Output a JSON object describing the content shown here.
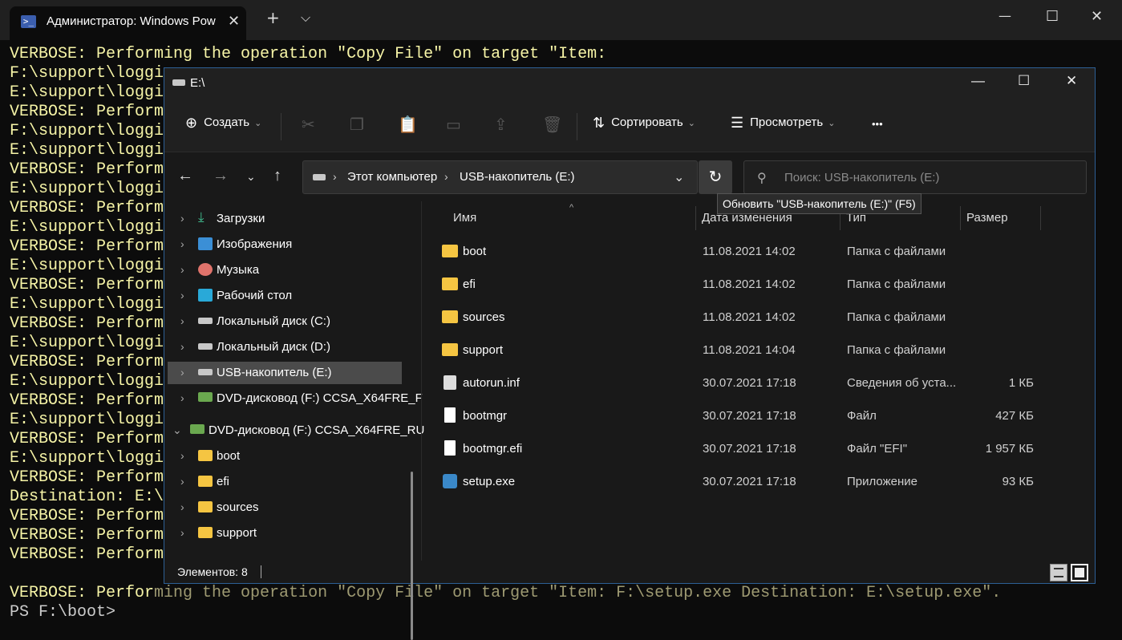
{
  "terminal": {
    "tab_title": "Администратор: Windows Pow",
    "tab_close": "✕",
    "new_tab": "+",
    "dropdown": "⌵",
    "minimize": "—",
    "maximize": "☐",
    "close": "✕",
    "lines": [
      "VERBOSE: Performing the operation \"Copy File\" on target \"Item:",
      "F:\\support\\loggi",
      "E:\\support\\loggi",
      "VERBOSE: Perform",
      "F:\\support\\loggi",
      "E:\\support\\loggi",
      "VERBOSE: Perform",
      "E:\\support\\loggi",
      "VERBOSE: Perform",
      "E:\\support\\loggi",
      "VERBOSE: Perform",
      "E:\\support\\loggi",
      "VERBOSE: Perform",
      "E:\\support\\loggi",
      "VERBOSE: Perform",
      "E:\\support\\loggi",
      "VERBOSE: Perform",
      "E:\\support\\loggi",
      "VERBOSE: Perform",
      "E:\\support\\loggi",
      "VERBOSE: Perform",
      "E:\\support\\loggi",
      "VERBOSE: Perform",
      "Destination: E:\\",
      "VERBOSE: Perform",
      "VERBOSE: Perform",
      "VERBOSE: Perform"
    ],
    "last_line_bright": "VERBOSE: Perfor",
    "last_line_dim": "ming the operation \"Copy File\" on target \"Item: F:\\setup.exe Destination: E:\\setup.exe\".",
    "prompt": "PS F:\\boot>"
  },
  "explorer": {
    "title": "E:\\",
    "minimize": "—",
    "maximize": "☐",
    "close": "✕",
    "toolbar": {
      "create_label": "Создать",
      "sort_label": "Сортировать",
      "view_label": "Просмотреть",
      "more_label": "•••"
    },
    "address": {
      "segments": [
        "Этот компьютер",
        "USB-накопитель (E:)"
      ],
      "separator": "›"
    },
    "search_placeholder": "Поиск: USB-накопитель (E:)",
    "refresh_tooltip": "Обновить \"USB-накопитель (E:)\" (F5)",
    "nav": [
      {
        "label": "Загрузки"
      },
      {
        "label": "Изображения"
      },
      {
        "label": "Музыка"
      },
      {
        "label": "Рабочий стол"
      },
      {
        "label": "Локальный диск (C:)"
      },
      {
        "label": "Локальный диск (D:)"
      },
      {
        "label": "USB-накопитель (E:)"
      },
      {
        "label": "DVD-дисковод (F:) CCSA_X64FRE_F"
      },
      {
        "label": "DVD-дисковод (F:) CCSA_X64FRE_RU"
      },
      {
        "label": "boot"
      },
      {
        "label": "efi"
      },
      {
        "label": "sources"
      },
      {
        "label": "support"
      }
    ],
    "columns": {
      "name": "Имя",
      "date": "Дата изменения",
      "type": "Тип",
      "size": "Размер"
    },
    "files": [
      {
        "name": "boot",
        "date": "11.08.2021 14:02",
        "type": "Папка с файлами",
        "size": ""
      },
      {
        "name": "efi",
        "date": "11.08.2021 14:02",
        "type": "Папка с файлами",
        "size": ""
      },
      {
        "name": "sources",
        "date": "11.08.2021 14:02",
        "type": "Папка с файлами",
        "size": ""
      },
      {
        "name": "support",
        "date": "11.08.2021 14:04",
        "type": "Папка с файлами",
        "size": ""
      },
      {
        "name": "autorun.inf",
        "date": "30.07.2021 17:18",
        "type": "Сведения об уста...",
        "size": "1 КБ"
      },
      {
        "name": "bootmgr",
        "date": "30.07.2021 17:18",
        "type": "Файл",
        "size": "427 КБ"
      },
      {
        "name": "bootmgr.efi",
        "date": "30.07.2021 17:18",
        "type": "Файл \"EFI\"",
        "size": "1 957 КБ"
      },
      {
        "name": "setup.exe",
        "date": "30.07.2021 17:18",
        "type": "Приложение",
        "size": "93 КБ"
      }
    ],
    "status": "Элементов: 8"
  }
}
